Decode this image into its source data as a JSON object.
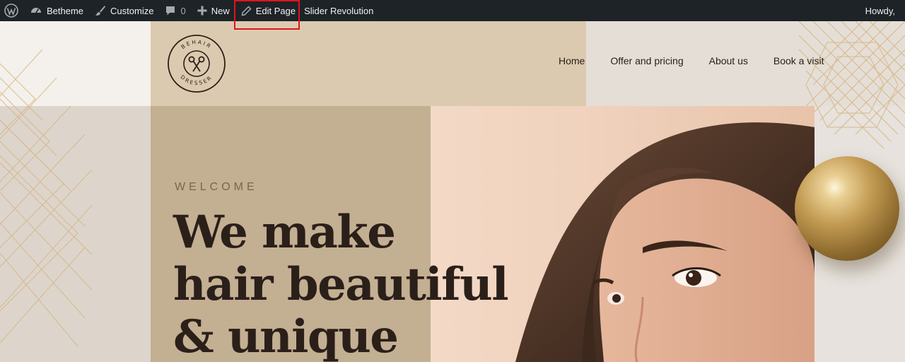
{
  "adminbar": {
    "site_name": "Betheme",
    "customize": "Customize",
    "comments_count": "0",
    "new_label": "New",
    "edit_page": "Edit Page",
    "slider": "Slider Revolution",
    "howdy": "Howdy,"
  },
  "logo": {
    "text_top": "BEHAIR",
    "text_bottom": "DRESSER"
  },
  "nav": {
    "items": [
      "Home",
      "Offer and pricing",
      "About us",
      "Book a visit"
    ]
  },
  "hero": {
    "welcome": "WELCOME",
    "headline": [
      "We make",
      "hair beautiful",
      "& unique"
    ]
  },
  "colors": {
    "adminbar_bg": "#1d2327",
    "header_tan": "#dccab0",
    "hero_tan": "#c3af92",
    "text_dark": "#2b1f1a",
    "highlight_red": "#e0141e",
    "gold": "#c29a52"
  }
}
